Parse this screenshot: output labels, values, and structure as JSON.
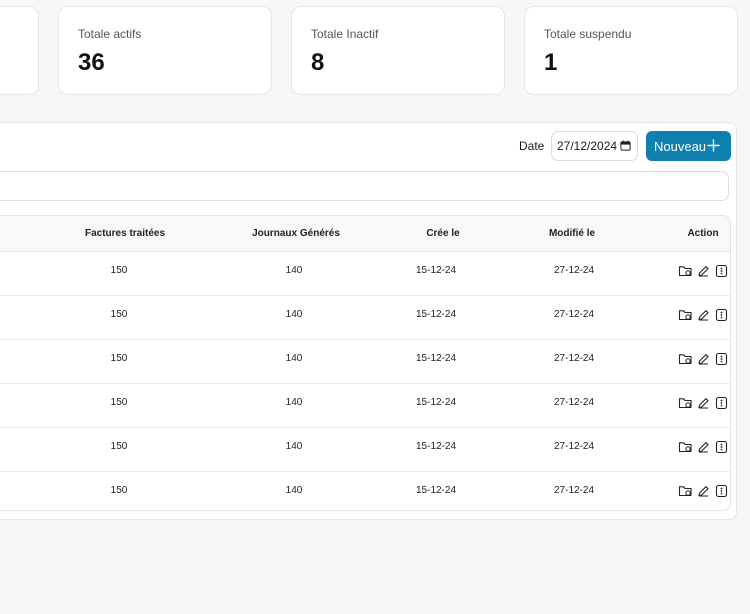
{
  "stats": [
    {
      "label": "Totale actifs",
      "value": "36"
    },
    {
      "label": "Totale Inactif",
      "value": "8"
    },
    {
      "label": "Totale suspendu",
      "value": "1"
    }
  ],
  "toolbar": {
    "date_label": "Date",
    "date_value": "27/12/2024",
    "new_label": "Nouveau"
  },
  "table": {
    "headers": [
      "Factures traitées",
      "Journaux Générés",
      "Crée le",
      "Modifié le",
      "Action"
    ],
    "rows": [
      [
        "150",
        "140",
        "15-12-24",
        "27-12-24"
      ],
      [
        "150",
        "140",
        "15-12-24",
        "27-12-24"
      ],
      [
        "150",
        "140",
        "15-12-24",
        "27-12-24"
      ],
      [
        "150",
        "140",
        "15-12-24",
        "27-12-24"
      ],
      [
        "150",
        "140",
        "15-12-24",
        "27-12-24"
      ],
      [
        "150",
        "140",
        "15-12-24",
        "27-12-24"
      ]
    ]
  },
  "icons": [
    "folder-icon",
    "edit-icon",
    "more-icon",
    "calendar-icon",
    "plus-icon"
  ],
  "colors": {
    "accent": "#0e7fae",
    "background": "#f7f7f7"
  }
}
